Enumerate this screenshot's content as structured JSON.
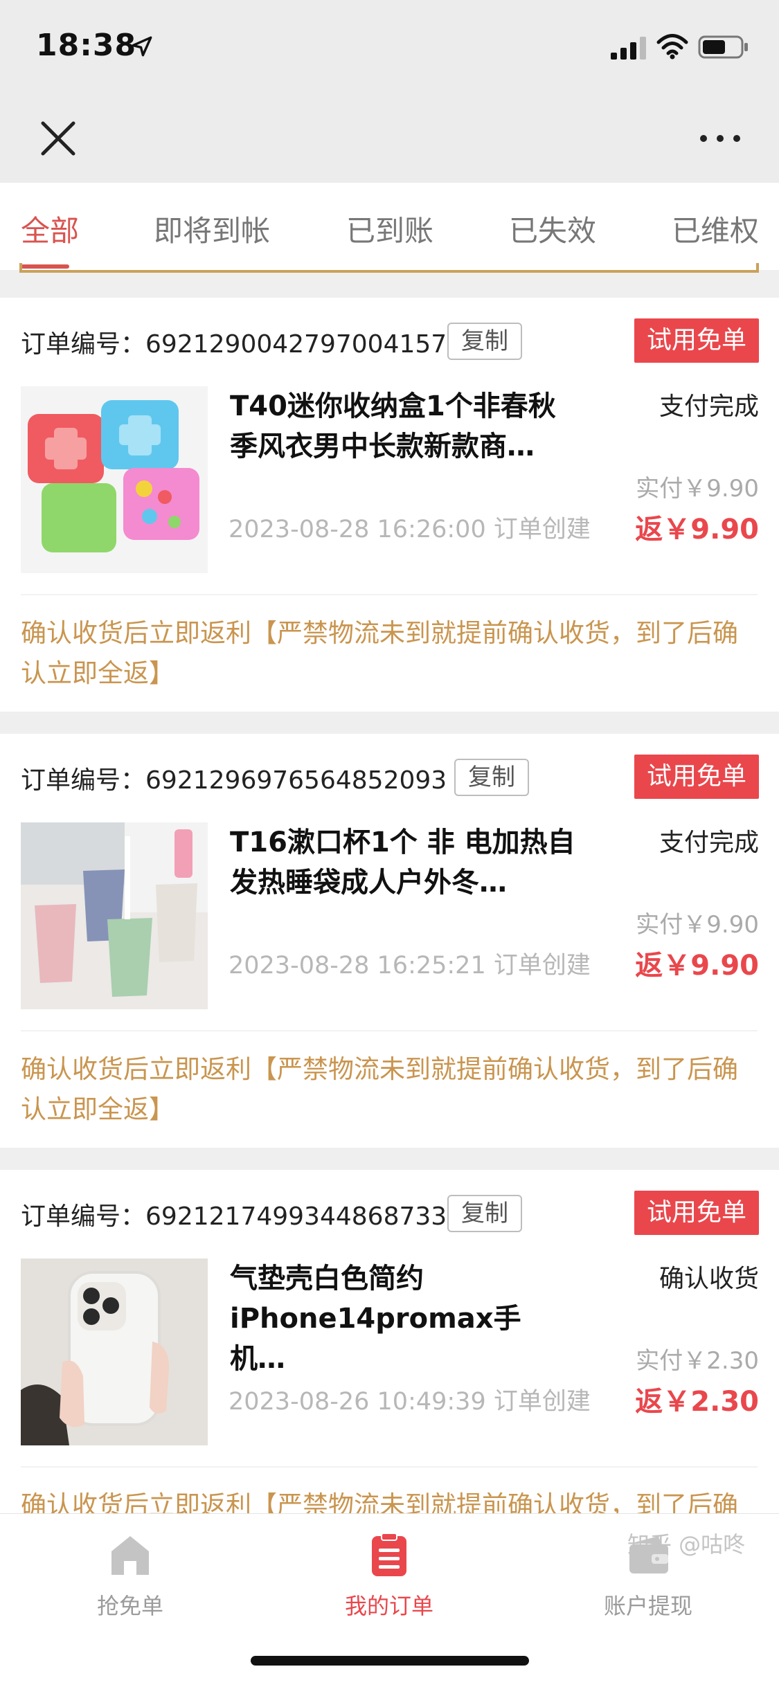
{
  "status_bar": {
    "time": "18:38"
  },
  "tabs": [
    {
      "label": "全部",
      "active": true
    },
    {
      "label": "即将到帐"
    },
    {
      "label": "已到账"
    },
    {
      "label": "已失效"
    },
    {
      "label": "已维权"
    }
  ],
  "orders": [
    {
      "order_label": "订单编号：",
      "order_no": "6921290042797004157",
      "copy_label": "复制",
      "badge": "试用免单",
      "title": "T40迷你收纳盒1个非春秋季风衣男中长款新款商…",
      "status": "支付完成",
      "paid": "实付￥9.90",
      "created": "2023-08-28 16:26:00 订单创建",
      "refund": "返￥9.90",
      "note": "确认收货后立即返利【严禁物流未到就提前确认收货，到了后确认立即全返】"
    },
    {
      "order_label": "订单编号：",
      "order_no": "6921296976564852093",
      "copy_label": "复制",
      "badge": "试用免单",
      "title": "T16漱口杯1个 非 电加热自发热睡袋成人户外冬…",
      "status": "支付完成",
      "paid": "实付￥9.90",
      "created": "2023-08-28 16:25:21 订单创建",
      "refund": "返￥9.90",
      "note": "确认收货后立即返利【严禁物流未到就提前确认收货，到了后确认立即全返】"
    },
    {
      "order_label": "订单编号：",
      "order_no": "6921217499344868733",
      "copy_label": "复制",
      "badge": "试用免单",
      "title": "气垫壳白色简约iPhone14promax手机…",
      "status": "确认收货",
      "paid": "实付￥2.30",
      "created": "2023-08-26 10:49:39 订单创建",
      "refund": "返￥2.30",
      "note": "确认收货后立即返利【严禁物流未到就提前确认收货，到了后确认立即全返】"
    }
  ],
  "bottom_nav": [
    {
      "label": "抢免单",
      "icon": "home-icon"
    },
    {
      "label": "我的订单",
      "icon": "order-list-icon",
      "active": true
    },
    {
      "label": "账户提现",
      "icon": "wallet-icon"
    }
  ],
  "watermark": "知乎 @咕咚",
  "colors": {
    "accent": "#e9474c",
    "note": "#c9954f",
    "tab_active": "#d9534f"
  }
}
